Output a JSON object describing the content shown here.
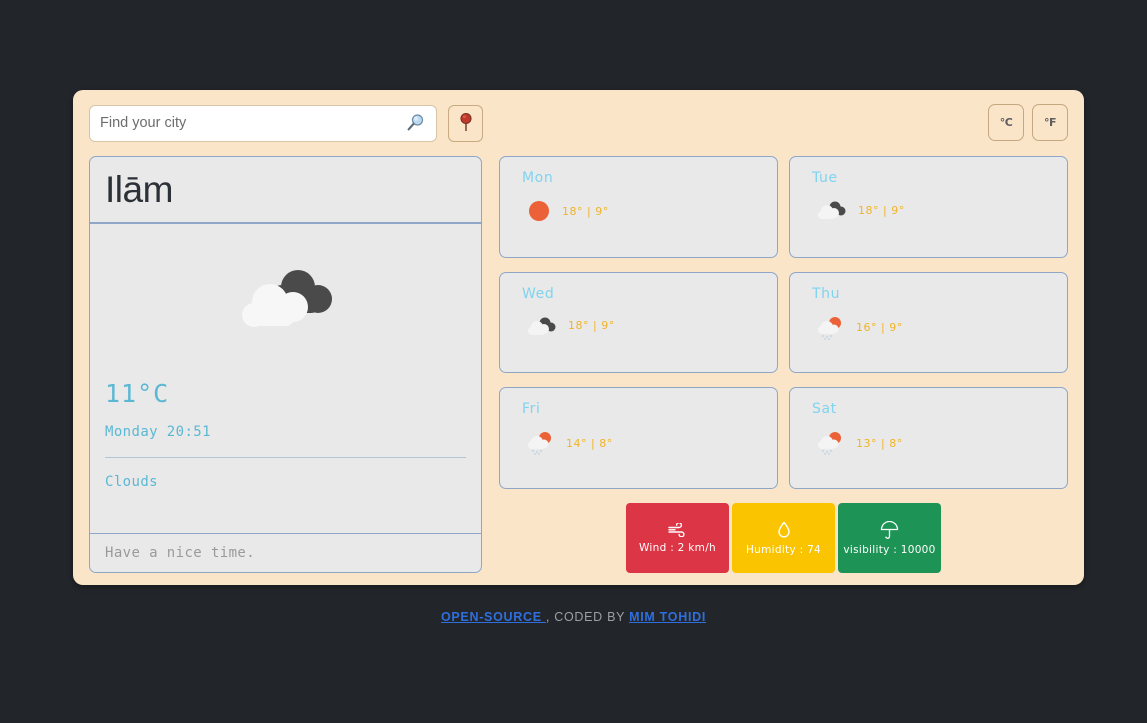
{
  "search": {
    "placeholder": "Find your city",
    "value": "",
    "search_icon": "magnifier-icon",
    "geolocate_icon": "map-pin-icon"
  },
  "units": {
    "celsius_label": "°C",
    "fahrenheit_label": "°F"
  },
  "current": {
    "city": "Ilām",
    "weather_icon": "broken-clouds-icon",
    "temperature": "11°C",
    "daytime": "Monday 20:51",
    "condition": "Clouds",
    "message": "Have a nice time."
  },
  "forecast": [
    {
      "day": "Mon",
      "icon": "sun-icon",
      "temps": "18° | 9°"
    },
    {
      "day": "Tue",
      "icon": "cloud-icon",
      "temps": "18° | 9°"
    },
    {
      "day": "Wed",
      "icon": "cloud-icon",
      "temps": "18° | 9°"
    },
    {
      "day": "Thu",
      "icon": "rain-sun-icon",
      "temps": "16° | 9°"
    },
    {
      "day": "Fri",
      "icon": "rain-sun-icon",
      "temps": "14° | 8°"
    },
    {
      "day": "Sat",
      "icon": "rain-sun-icon",
      "temps": "13° | 8°"
    }
  ],
  "stats": [
    {
      "label": "Wind : 2 km/h",
      "icon": "wind-icon",
      "color": "#dc3545"
    },
    {
      "label": "Humidity : 74",
      "icon": "droplet-icon",
      "color": "#fac400"
    },
    {
      "label": "visibility : 10000",
      "icon": "umbrella-icon",
      "color": "#1d9455"
    }
  ],
  "footer": {
    "link1": "OPEN-SOURCE ",
    "separator": ", CODED BY ",
    "link2": "MIM TOHIDI"
  },
  "colors": {
    "panel_bg": "#fae5c9",
    "page_bg": "#22252a",
    "card_bg": "#e9e9e9",
    "card_border": "#8ea7c6",
    "accent_blue": "#5bb8d4",
    "day_blue": "#7fd4ef",
    "temp_gold": "#f0b429"
  }
}
